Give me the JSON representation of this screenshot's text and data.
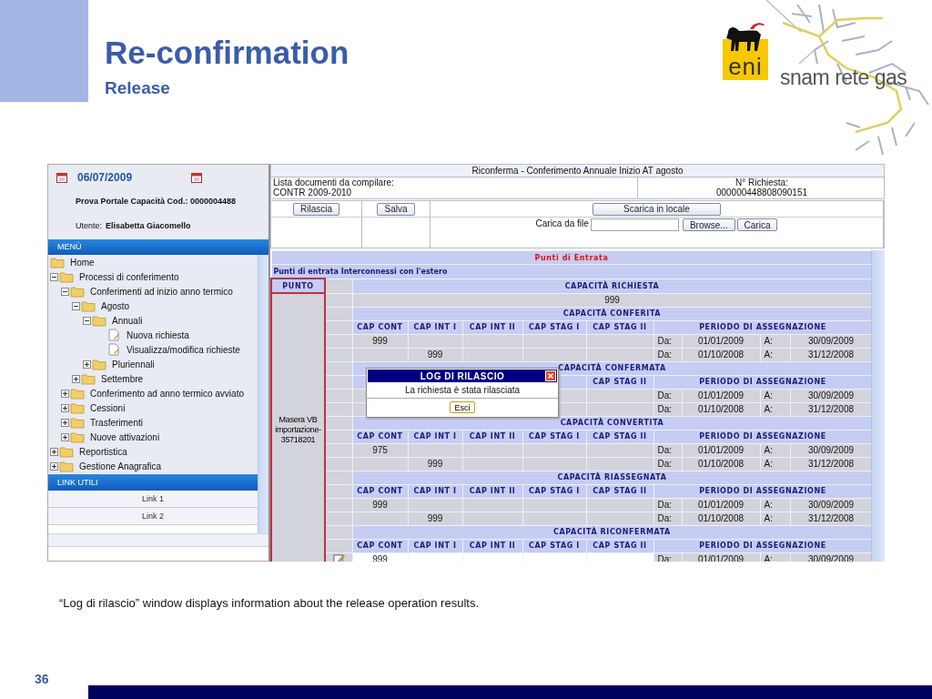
{
  "slide": {
    "title": "Re-confirmation",
    "subtitle": "Release",
    "caption": "“Log di rilascio” window displays information about the release operation results.",
    "page_number": "36"
  },
  "logos": {
    "eni": "eni",
    "snam": "snam rete gas"
  },
  "sidebar": {
    "date": "06/07/2009",
    "portal": "Prova Portale Capacità Cod.: 0000004488",
    "user_label": "Utente:",
    "user_name": "Elisabetta Giacomello",
    "menu_title": "MENÙ",
    "links_title": "LINK UTILI",
    "links": [
      "Link 1",
      "Link 2"
    ],
    "tree": [
      {
        "label": "Home",
        "kind": "home"
      },
      {
        "label": "Processi di conferimento",
        "kind": "folder",
        "expanded": true,
        "children": [
          {
            "label": "Conferimenti ad inizio anno termico",
            "kind": "folder",
            "expanded": true,
            "children": [
              {
                "label": "Agosto",
                "kind": "folder",
                "expanded": true,
                "children": [
                  {
                    "label": "Annuali",
                    "kind": "folder",
                    "expanded": true,
                    "children": [
                      {
                        "label": "Nuova richiesta",
                        "kind": "page"
                      },
                      {
                        "label": "Visualizza/modifica richieste",
                        "kind": "page"
                      }
                    ]
                  },
                  {
                    "label": "Pluriennali",
                    "kind": "folder",
                    "expanded": false
                  }
                ]
              },
              {
                "label": "Settembre",
                "kind": "folder",
                "expanded": false
              }
            ]
          },
          {
            "label": "Conferimento ad anno termico avviato",
            "kind": "folder",
            "expanded": false
          },
          {
            "label": "Cessioni",
            "kind": "folder",
            "expanded": false
          },
          {
            "label": "Trasferimenti",
            "kind": "folder",
            "expanded": false
          },
          {
            "label": "Nuove attivazioni",
            "kind": "folder",
            "expanded": false
          }
        ]
      },
      {
        "label": "Reportistica",
        "kind": "folder",
        "expanded": false
      },
      {
        "label": "Gestione Anagrafica",
        "kind": "folder",
        "expanded": false
      }
    ]
  },
  "form": {
    "title": "Riconferma - Conferimento Annuale Inizio AT agosto",
    "doc_label": "Lista documenti da compilare:",
    "doc_value": "CONTR 2009-2010",
    "request_label": "N° Richiesta:",
    "request_value": "000000448808090151",
    "release_button": "Rilascia",
    "save_button": "Salva",
    "download_button": "Scarica in locale",
    "upload_label": "Carica da file",
    "browse_button": "Browse...",
    "upload_button": "Carica"
  },
  "table": {
    "section_title": "Punti di Entrata",
    "subtitle": "Punti di entrata Interconnessi con l'estero",
    "point_header": "PUNTO",
    "point_value": "Masera VB importazione-35718201",
    "requested_title": "CAPACITÀ RICHIESTA",
    "requested_value": "999",
    "blocks": [
      {
        "title": "CAPACITÀ CONFERITA",
        "columns": [
          "CAP CONT",
          "CAP INT I",
          "CAP INT II",
          "CAP STAG I",
          "CAP STAG II",
          "PERIODO DI ASSEGNAZIONE"
        ],
        "rows": [
          {
            "cells": [
              "999",
              null,
              null,
              null,
              null
            ],
            "from_label": "Da:",
            "from": "01/01/2009",
            "to_label": "A:",
            "to": "30/09/2009",
            "editable": false
          },
          {
            "cells": [
              null,
              "999",
              null,
              null,
              null
            ],
            "from_label": "Da:",
            "from": "01/10/2008",
            "to_label": "A:",
            "to": "31/12/2008",
            "editable": false
          }
        ]
      },
      {
        "title": "CAPACITÀ CONFERMATA",
        "columns": [
          null,
          null,
          null,
          null,
          "CAP STAG II",
          "PERIODO DI ASSEGNAZIONE"
        ],
        "rows": [
          {
            "cells": [
              null,
              null,
              null,
              null,
              null
            ],
            "from_label": "Da:",
            "from": "01/01/2009",
            "to_label": "A:",
            "to": "30/09/2009",
            "editable": false
          },
          {
            "cells": [
              null,
              null,
              null,
              null,
              null
            ],
            "from_label": "Da:",
            "from": "01/10/2008",
            "to_label": "A:",
            "to": "31/12/2008",
            "editable": false
          }
        ]
      },
      {
        "title": "CAPACITÀ CONVERTITA",
        "columns": [
          "CAP CONT",
          "CAP INT I",
          "CAP INT II",
          "CAP STAG I",
          "CAP STAG II",
          "PERIODO DI ASSEGNAZIONE"
        ],
        "rows": [
          {
            "cells": [
              "975",
              null,
              null,
              null,
              null
            ],
            "from_label": "Da:",
            "from": "01/01/2009",
            "to_label": "A:",
            "to": "30/09/2009",
            "editable": false
          },
          {
            "cells": [
              null,
              "999",
              null,
              null,
              null
            ],
            "from_label": "Da:",
            "from": "01/10/2008",
            "to_label": "A:",
            "to": "31/12/2008",
            "editable": false
          }
        ]
      },
      {
        "title": "CAPACITÀ RIASSEGNATA",
        "columns": [
          "CAP CONT",
          "CAP INT I",
          "CAP INT II",
          "CAP STAG I",
          "CAP STAG II",
          "PERIODO DI ASSEGNAZIONE"
        ],
        "rows": [
          {
            "cells": [
              "999",
              null,
              null,
              null,
              null
            ],
            "from_label": "Da:",
            "from": "01/01/2009",
            "to_label": "A:",
            "to": "30/09/2009",
            "editable": false
          },
          {
            "cells": [
              null,
              "999",
              null,
              null,
              null
            ],
            "from_label": "Da:",
            "from": "01/10/2008",
            "to_label": "A:",
            "to": "31/12/2008",
            "editable": false
          }
        ]
      },
      {
        "title": "CAPACITÀ RICONFERMATA",
        "columns": [
          "CAP CONT",
          "CAP INT I",
          "CAP INT II",
          "CAP STAG I",
          "CAP STAG II",
          "PERIODO DI ASSEGNAZIONE"
        ],
        "rows": [
          {
            "cells": [
              "999",
              null,
              null,
              null,
              null
            ],
            "from_label": "Da:",
            "from": "01/01/2009",
            "to_label": "A:",
            "to": "30/09/2009",
            "editable": true
          }
        ]
      }
    ]
  },
  "dialog": {
    "title": "LOG DI RILASCIO",
    "message": "La richiesta è stata rilasciata",
    "button": "Esci"
  }
}
